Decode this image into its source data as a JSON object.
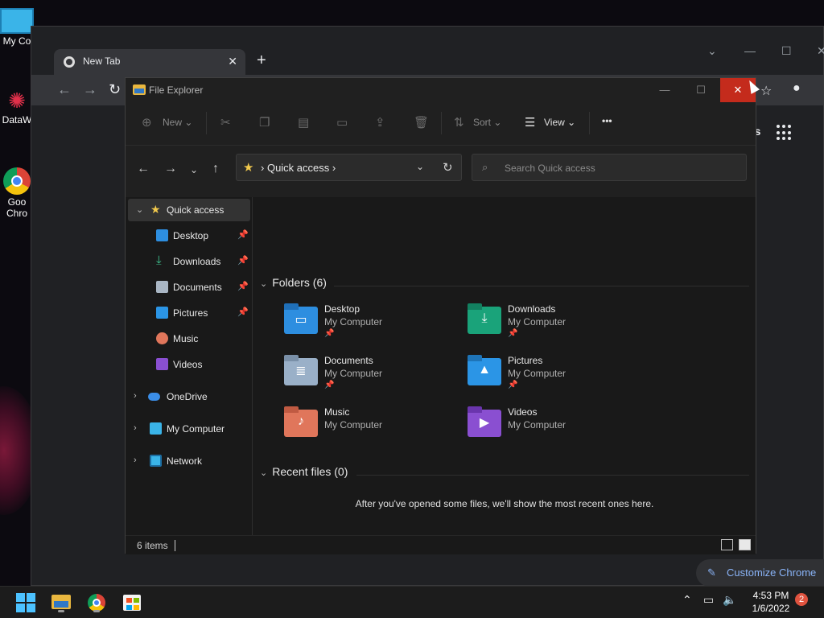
{
  "desktop": {
    "icons": [
      {
        "label": "My Co",
        "icon": "monitor-icon"
      },
      {
        "label": "DataW",
        "icon": "datawrapper-icon"
      },
      {
        "label": "Goo",
        "label2": "Chro",
        "icon": "chrome-icon"
      }
    ]
  },
  "chrome": {
    "tab_title": "New Tab",
    "images_link": "mages",
    "customize_label": "Customize Chrome"
  },
  "explorer": {
    "title": "File Explorer",
    "toolbar": {
      "new_label": "New",
      "sort_label": "Sort",
      "view_label": "View",
      "more_label": "•••"
    },
    "address": {
      "crumb": "Quick access"
    },
    "search": {
      "placeholder": "Search Quick access"
    },
    "sidebar": {
      "quick_access": "Quick access",
      "pinned": [
        {
          "label": "Desktop",
          "pinned": true
        },
        {
          "label": "Downloads",
          "pinned": true
        },
        {
          "label": "Documents",
          "pinned": true
        },
        {
          "label": "Pictures",
          "pinned": true
        },
        {
          "label": "Music",
          "pinned": false
        },
        {
          "label": "Videos",
          "pinned": false
        }
      ],
      "onedrive": "OneDrive",
      "mycomputer": "My Computer",
      "network": "Network"
    },
    "folders_header": "Folders (6)",
    "folders": [
      {
        "name": "Desktop",
        "location": "My Computer",
        "pinned": true,
        "color": "#2d8ee0"
      },
      {
        "name": "Downloads",
        "location": "My Computer",
        "pinned": true,
        "color": "#1aa37a"
      },
      {
        "name": "Documents",
        "location": "My Computer",
        "pinned": true,
        "color": "#9ab0c8"
      },
      {
        "name": "Pictures",
        "location": "My Computer",
        "pinned": true,
        "color": "#2b95e6"
      },
      {
        "name": "Music",
        "location": "My Computer",
        "pinned": false,
        "color": "#e0765b"
      },
      {
        "name": "Videos",
        "location": "My Computer",
        "pinned": false,
        "color": "#8a4fd1"
      }
    ],
    "recent_header": "Recent files (0)",
    "recent_empty": "After you've opened some files, we'll show the most recent ones here.",
    "status_count": "6 items"
  },
  "taskbar": {
    "time": "4:53 PM",
    "date": "1/6/2022",
    "notifications": "2"
  },
  "colors": {
    "accent": "#4cc2ff",
    "close_red": "#c42b1c",
    "star": "#f2c94c"
  }
}
